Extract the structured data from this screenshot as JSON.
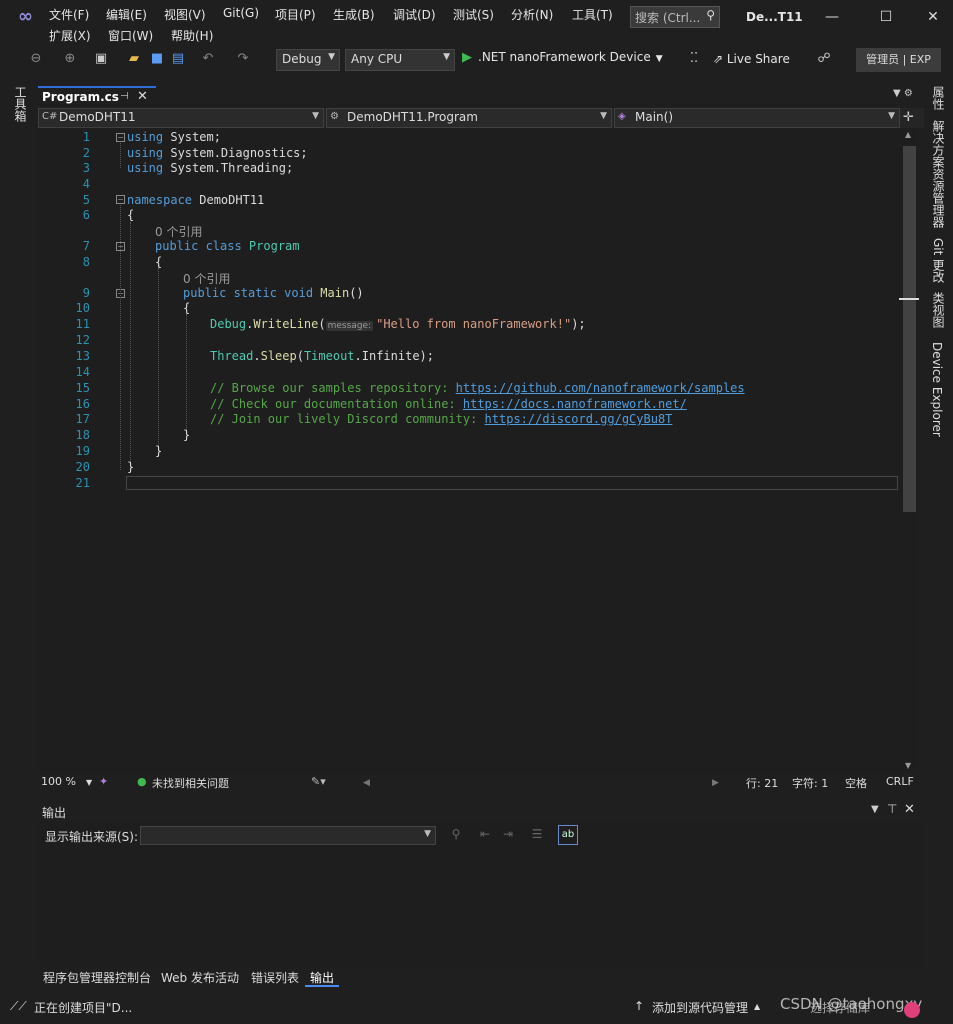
{
  "menu": {
    "row1": [
      "文件(F)",
      "编辑(E)",
      "视图(V)",
      "Git(G)",
      "项目(P)",
      "生成(B)",
      "调试(D)",
      "测试(S)",
      "分析(N)",
      "工具(T)"
    ],
    "row2": [
      "扩展(X)",
      "窗口(W)",
      "帮助(H)"
    ]
  },
  "search": {
    "placeholder": "搜索 (Ctrl..."
  },
  "window_title": "De...T11",
  "toolbar": {
    "config": "Debug",
    "platform": "Any CPU",
    "run_target": ".NET nanoFramework Device",
    "live_share": "Live Share",
    "admin": "管理员 | EXP"
  },
  "left_rail": {
    "toolbox": "工具箱"
  },
  "right_rail": [
    "属性",
    "解决方案资源管理器",
    "Git 更改",
    "类视图",
    "Device Explorer"
  ],
  "editor_tab": {
    "label": "Program.cs"
  },
  "navbar": {
    "project": "DemoDHT11",
    "class": "DemoDHT11.Program",
    "member": "Main()"
  },
  "code": {
    "line_numbers": [
      "1",
      "2",
      "3",
      "4",
      "5",
      "6",
      "7",
      "8",
      "9",
      "10",
      "11",
      "12",
      "13",
      "14",
      "15",
      "16",
      "17",
      "18",
      "19",
      "20",
      "21"
    ],
    "l1_kw": "using",
    "l1_rest": " System;",
    "l2_kw": "using",
    "l2_rest": " System.Diagnostics;",
    "l3_kw": "using",
    "l3_rest": " System.Threading;",
    "l5_kw": "namespace",
    "l5_rest": " DemoDHT11",
    "l6": "{",
    "ref1": "0 个引用",
    "l7_kw": "public class ",
    "l7_type": "Program",
    "l8": "{",
    "ref2": "0 个引用",
    "l9_kw": "public static void ",
    "l9_fn": "Main",
    "l9_rest": "()",
    "l10": "{",
    "l11_type": "Debug",
    "l11_dot": ".",
    "l11_fn": "WriteLine",
    "l11_open": "(",
    "l11_hint": "message:",
    "l11_str": "\"Hello from nanoFramework!\"",
    "l11_close": ");",
    "l13_type": "Thread",
    "l13_dot": ".",
    "l13_fn": "Sleep",
    "l13_open": "(",
    "l13_type2": "Timeout",
    "l13_rest": ".Infinite);",
    "l15_cm": "// Browse our samples repository: ",
    "l15_url": "https://github.com/nanoframework/samples",
    "l16_cm": "// Check our documentation online: ",
    "l16_url": "https://docs.nanoframework.net/",
    "l17_cm": "// Join our lively Discord community: ",
    "l17_url": "https://discord.gg/gCyBu8T",
    "l18": "}",
    "l19": "}",
    "l20": "}"
  },
  "editor_status": {
    "zoom": "100 %",
    "issues": "未找到相关问题",
    "line": "行: 21",
    "col": "字符: 1",
    "spaces": "空格",
    "eol": "CRLF"
  },
  "output": {
    "title": "输出",
    "source_label": "显示输出来源(S):",
    "source_value": ""
  },
  "bottom_tabs": [
    "程序包管理器控制台",
    "Web 发布活动",
    "错误列表",
    "输出"
  ],
  "statusbar": {
    "left": "正在创建项目\"D...",
    "source_control": "添加到源代码管理",
    "repo": "选择存储库"
  },
  "watermark": "CSDN @taohongxy",
  "colors": {
    "accent": "#2e6fd6",
    "run_green": "#3fb950",
    "keyword": "#569cd6",
    "type": "#4ec9b0",
    "comment": "#57a64a",
    "string": "#d69d85"
  }
}
